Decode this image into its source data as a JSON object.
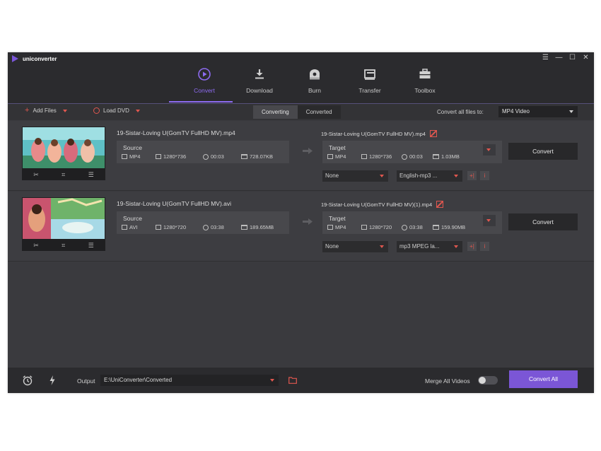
{
  "app": {
    "title": "uniconverter",
    "accent": "#8d6bf0"
  },
  "window_controls": {
    "menu": "☰",
    "minimize": "—",
    "maximize": "☐",
    "close": "✕"
  },
  "nav": [
    {
      "label": "Convert",
      "icon": "convert-icon",
      "active": true
    },
    {
      "label": "Download",
      "icon": "download-icon",
      "active": false
    },
    {
      "label": "Burn",
      "icon": "burn-icon",
      "active": false
    },
    {
      "label": "Transfer",
      "icon": "transfer-icon",
      "active": false
    },
    {
      "label": "Toolbox",
      "icon": "toolbox-icon",
      "active": false
    }
  ],
  "toolbar": {
    "add_files": "Add Files",
    "load_dvd": "Load DVD",
    "tabs": [
      "Converting",
      "Converted"
    ],
    "convert_all_label": "Convert all files to:",
    "format": "MP4 Video"
  },
  "files": [
    {
      "name": "19-Sistar-Loving U(GomTV FullHD MV).mp4",
      "source": {
        "label": "Source",
        "format": "MP4",
        "resolution": "1280*736",
        "duration": "00:03",
        "size": "728.07KB"
      },
      "target_name": "19-Sistar-Loving U(GomTV FullHD MV).mp4",
      "target": {
        "label": "Target",
        "format": "MP4",
        "resolution": "1280*736",
        "duration": "00:03",
        "size": "1.03MB"
      },
      "subtitle": "None",
      "audio": "English-mp3 ...",
      "convert_label": "Convert"
    },
    {
      "name": "19-Sistar-Loving U(GomTV FullHD MV).avi",
      "source": {
        "label": "Source",
        "format": "AVI",
        "resolution": "1280*720",
        "duration": "03:38",
        "size": "189.65MB"
      },
      "target_name": "19-Sistar-Loving U(GomTV FullHD MV)(1).mp4",
      "target": {
        "label": "Target",
        "format": "MP4",
        "resolution": "1280*720",
        "duration": "03:38",
        "size": "159.90MB"
      },
      "subtitle": "None",
      "audio": "mp3 MPEG la...",
      "convert_label": "Convert"
    }
  ],
  "bottom": {
    "output_label": "Output",
    "output_path": "E:\\UniConverter\\Converted",
    "merge_label": "Merge All Videos",
    "merge_on": false,
    "convert_all": "Convert All"
  }
}
